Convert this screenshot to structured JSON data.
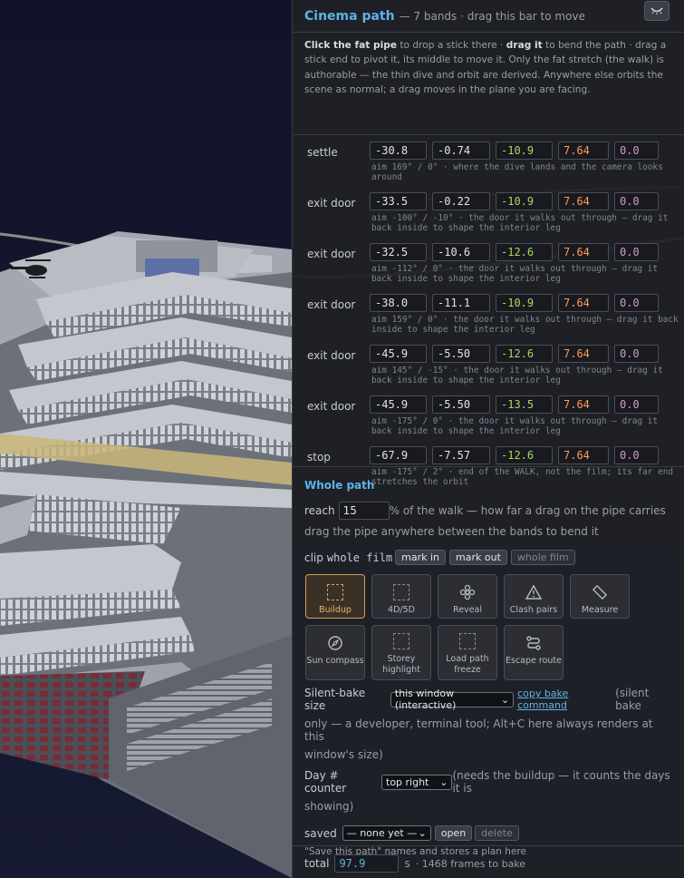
{
  "header": {
    "title": "Cinema path",
    "subtitle": "— 7 bands · drag this bar to move",
    "collapse_icon": "chevron-down-icon"
  },
  "intro": {
    "p1b": "Click the fat pipe",
    "p1": " to drop a stick there · ",
    "p2b": "drag it",
    "p2": " to bend the path · drag a stick end to pivot it, its middle to move it. Only the fat stretch (the walk) is authorable — the thin dive and orbit are derived. Anywhere else orbits the scene as normal; a drag moves in the plane you are facing."
  },
  "bands": [
    {
      "label": "settle",
      "values": [
        "-30.8",
        "-0.74",
        "-10.9",
        "7.64",
        "0.0"
      ],
      "aim": "aim 169° / 0° · where the dive lands and the camera looks around"
    },
    {
      "label": "exit door",
      "values": [
        "-33.5",
        "-0.22",
        "-10.9",
        "7.64",
        "0.0"
      ],
      "aim": "aim -100° / -10° · the door it walks out through — drag it back inside to shape the interior leg"
    },
    {
      "label": "exit door",
      "values": [
        "-32.5",
        "-10.6",
        "-12.6",
        "7.64",
        "0.0"
      ],
      "aim": "aim -112° / 0° · the door it walks out through — drag it back inside to shape the interior leg"
    },
    {
      "label": "exit door",
      "values": [
        "-38.0",
        "-11.1",
        "-10.9",
        "7.64",
        "0.0"
      ],
      "aim": "aim 159° / 0° · the door it walks out through — drag it back inside to shape the interior leg"
    },
    {
      "label": "exit door",
      "values": [
        "-45.9",
        "-5.50",
        "-12.6",
        "7.64",
        "0.0"
      ],
      "aim": "aim 145° / -15° · the door it walks out through — drag it back inside to shape the interior leg"
    },
    {
      "label": "exit door",
      "values": [
        "-45.9",
        "-5.50",
        "-13.5",
        "7.64",
        "0.0"
      ],
      "aim": "aim -175° / 0° · the door it walks out through — drag it back inside to shape the interior leg"
    },
    {
      "label": "stop",
      "values": [
        "-67.9",
        "-7.57",
        "-12.6",
        "7.64",
        "0.0"
      ],
      "aim": "aim -175° / 2° · end of the WALK, not the film; its far end stretches the orbit"
    }
  ],
  "whole": {
    "title": "Whole path",
    "reach_label": "reach",
    "reach_value": "15",
    "reach_suffix": "% of the walk — how far a drag on the pipe carries",
    "reach_hint": "drag the pipe anywhere between the bands to bend it",
    "clip_label": "clip",
    "clip_mono": "whole film",
    "mark_in": "mark in",
    "mark_out": "mark out",
    "whole_film": "whole film"
  },
  "tools": [
    {
      "label": "Buildup",
      "icon": "dashed-square-icon",
      "active": true
    },
    {
      "label": "4D/5D",
      "icon": "dashed-square-icon",
      "active": false
    },
    {
      "label": "Reveal",
      "icon": "flower-icon",
      "active": false
    },
    {
      "label": "Clash pairs",
      "icon": "warning-triangle-icon",
      "active": false
    },
    {
      "label": "Measure",
      "icon": "ruler-icon",
      "active": false
    },
    {
      "label": "Sun compass",
      "icon": "compass-icon",
      "active": false
    },
    {
      "label": "Storey highlight",
      "icon": "dashed-square-icon",
      "active": false
    },
    {
      "label": "Load path freeze",
      "icon": "dashed-square-icon",
      "active": false
    },
    {
      "label": "Escape route",
      "icon": "route-icon",
      "active": false
    }
  ],
  "silent": {
    "label": "Silent-bake size",
    "select": "this window (interactive)",
    "link": "copy bake command",
    "note1": " (silent bake",
    "note2": "only — a developer, terminal tool; Alt+C here always renders at this",
    "note3": "window's size)"
  },
  "day": {
    "label": "Day # counter",
    "select": "top right",
    "note1": " (needs the buildup — it counts the days it is",
    "note2": "showing)"
  },
  "saved": {
    "label": "saved",
    "select": "— none yet —",
    "open": "open",
    "delete": "delete",
    "hint": "\"Save this path\" names and stores a plan here"
  },
  "total": {
    "label": "total",
    "value": "97.9",
    "unit": "s",
    "frames": "· 1468 frames to bake"
  }
}
